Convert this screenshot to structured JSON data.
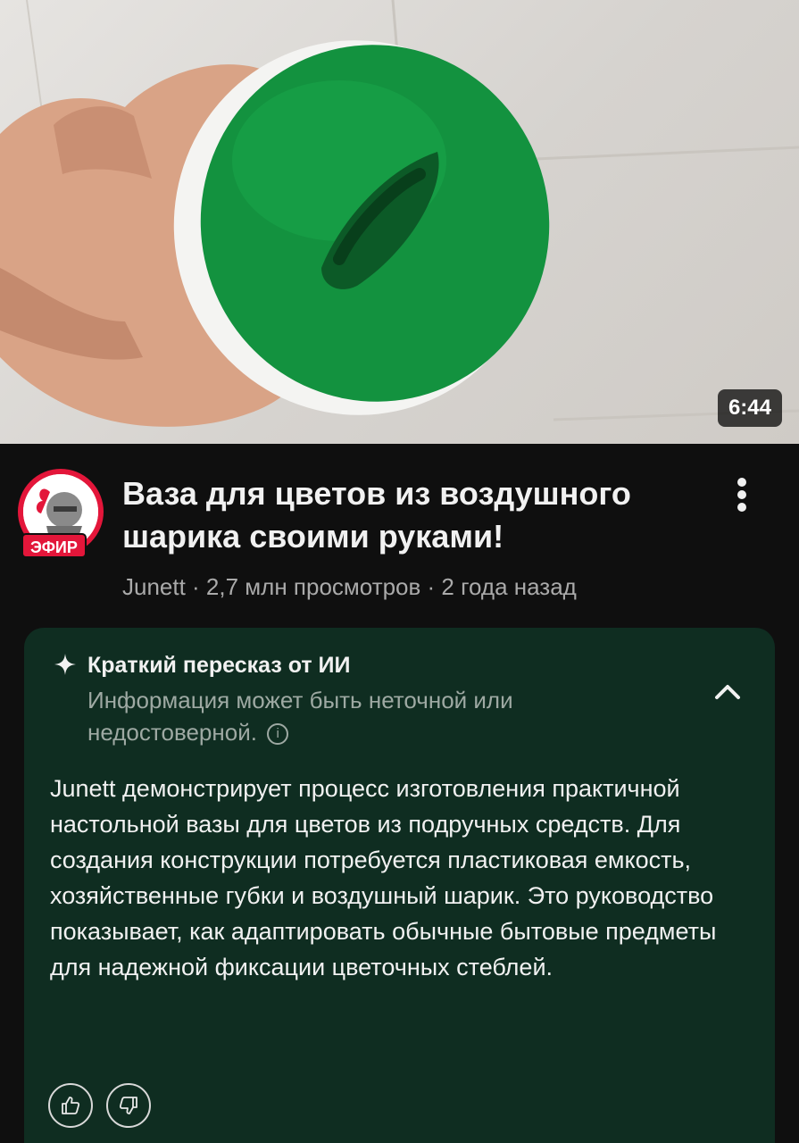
{
  "video": {
    "duration": "6:44",
    "title": "Ваза для цветов из воздушного шарика своими руками!",
    "meta": "Junett · 2,7 млн просмотров · 2 года назад"
  },
  "channel": {
    "badge": "ЭФИР"
  },
  "ai_summary": {
    "title": "Краткий пересказ от ИИ",
    "disclaimer": "Информация может быть неточной или недостоверной.",
    "info_glyph": "i",
    "text": "Junett демонстрирует процесс изготовления практичной настольной вазы для цветов из подручных средств. Для создания конструкции потребуется пластиковая емкость, хозяйственные губки и воздушный шарик. Это руководство показывает, как адаптировать обычные бытовые предметы для надежной фиксации цветочных стеблей."
  },
  "colors": {
    "background": "#0f0f0f",
    "card": "#0f2d21",
    "accent_red": "#e3163a",
    "balloon_green": "#13923f"
  },
  "icons": [
    "sparkle-icon",
    "info-icon",
    "chevron-up-icon",
    "more-vert-icon",
    "thumbs-up-icon",
    "thumbs-down-icon"
  ]
}
